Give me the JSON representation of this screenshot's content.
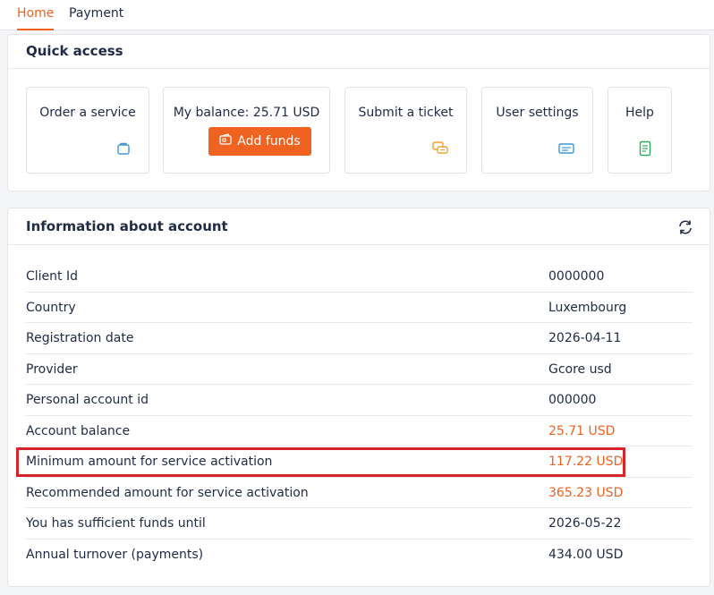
{
  "tabs": [
    {
      "label": "Home",
      "active": true
    },
    {
      "label": "Payment",
      "active": false
    }
  ],
  "quick_access": {
    "title": "Quick access",
    "tiles": [
      {
        "label": "Order a service",
        "icon": "bag-icon"
      },
      {
        "label": "My balance: 25.71 USD",
        "button": "Add funds",
        "icon": "wallet-icon"
      },
      {
        "label": "Submit a ticket",
        "icon": "chat-icon"
      },
      {
        "label": "User settings",
        "icon": "settings-card-icon"
      },
      {
        "label": "Help",
        "icon": "document-icon"
      }
    ]
  },
  "account": {
    "title": "Information about account",
    "rows": [
      {
        "key": "Client Id",
        "value": "0000000"
      },
      {
        "key": "Country",
        "value": "Luxembourg"
      },
      {
        "key": "Registration date",
        "value": "2026-04-11"
      },
      {
        "key": "Provider",
        "value": "Gcore usd"
      },
      {
        "key": "Personal account id",
        "value": "000000"
      },
      {
        "key": "Account balance",
        "value": "25.71 USD"
      },
      {
        "key": "Minimum amount for service activation",
        "value": "117.22 USD"
      },
      {
        "key": "Recommended amount for service activation",
        "value": "365.23 USD"
      },
      {
        "key": "You has sufficient funds until",
        "value": "2026-05-22"
      },
      {
        "key": "Annual turnover (payments)",
        "value": "434.00 USD"
      }
    ]
  },
  "colors": {
    "accent": "#f0621f",
    "highlight_box": "#d9232a",
    "icon_blue": "#3b97d3",
    "icon_orange": "#f0a030",
    "icon_green": "#2eaa5c"
  }
}
